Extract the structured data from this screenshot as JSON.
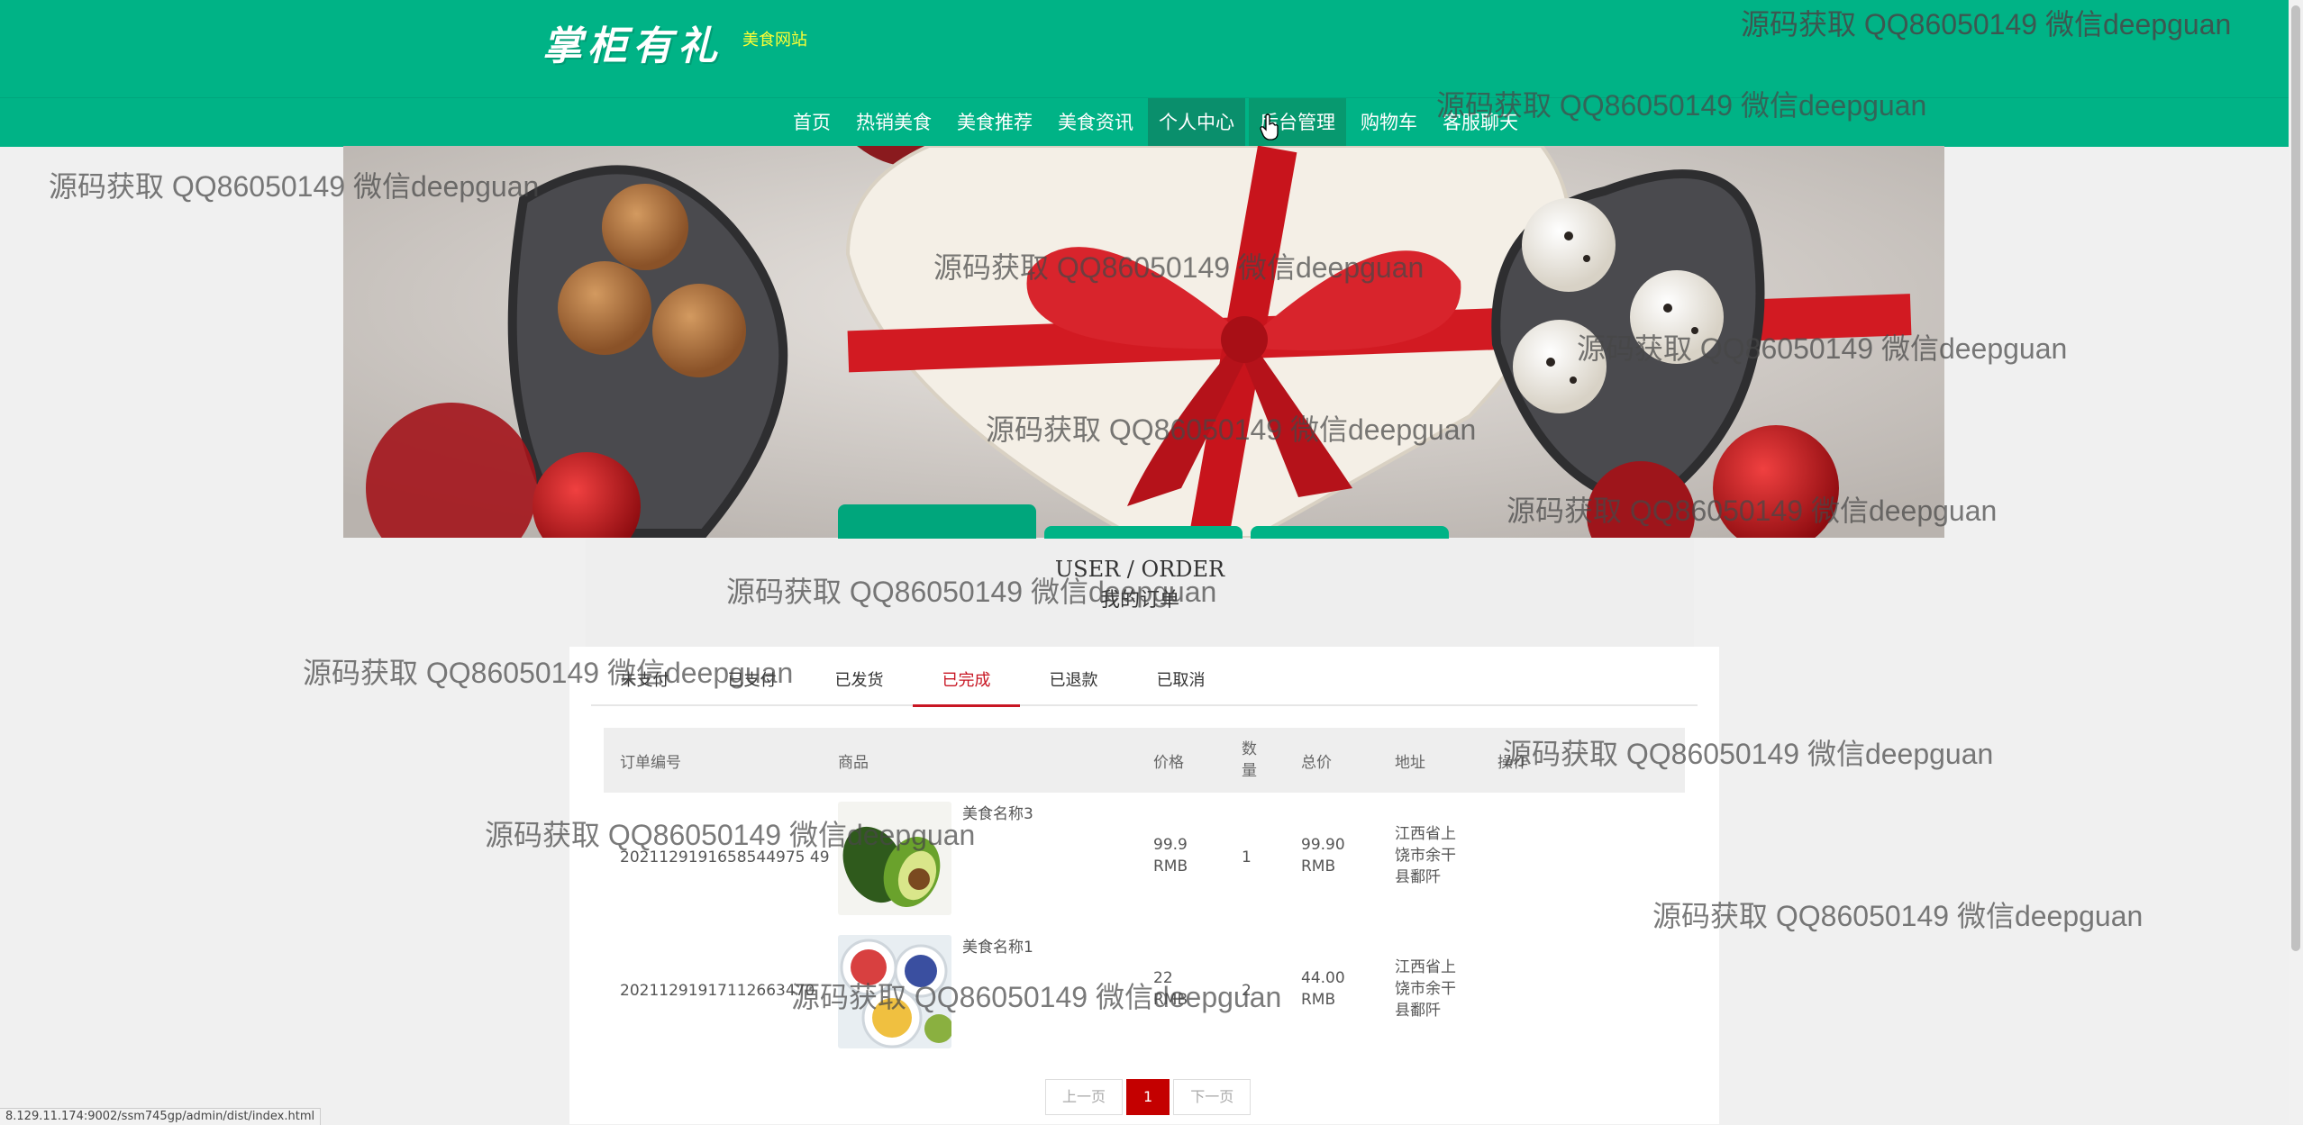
{
  "header": {
    "logo_text": "掌柜有礼",
    "logo_subtitle": "美食网站"
  },
  "nav": {
    "items": [
      {
        "label": "首页"
      },
      {
        "label": "热销美食"
      },
      {
        "label": "美食推荐"
      },
      {
        "label": "美食资讯"
      },
      {
        "label": "个人中心"
      },
      {
        "label": "后台管理"
      },
      {
        "label": "购物车"
      },
      {
        "label": "客服聊天"
      }
    ],
    "active": "个人中心",
    "hovered": "后台管理"
  },
  "order_section": {
    "heading_en": "USER / ORDER",
    "heading_cn": "我的订单"
  },
  "tabs": [
    {
      "label": "未支付"
    },
    {
      "label": "已支付"
    },
    {
      "label": "已发货"
    },
    {
      "label": "已完成"
    },
    {
      "label": "已退款"
    },
    {
      "label": "已取消"
    }
  ],
  "active_tab": "已完成",
  "table": {
    "headers": {
      "order_no": "订单编号",
      "goods": "商品",
      "price": "价格",
      "qty": "数量",
      "total": "总价",
      "address": "地址",
      "action": "操作"
    },
    "rows": [
      {
        "order_no": "20211291916585449754 9",
        "order_no_display": "2021129191658544975 49",
        "goods_name": "美食名称3",
        "price": "99.9 RMB",
        "qty": "1",
        "total": "99.90 RMB",
        "address": "江西省上饶市余干县鄱阡",
        "image": "avocado-image"
      },
      {
        "order_no_display": "20211291917112663470",
        "goods_name": "美食名称1",
        "price": "22 RMB",
        "qty": "2",
        "total": "44.00 RMB",
        "address": "江西省上饶市余干县鄱阡",
        "image": "yogurt-bowls-image"
      }
    ]
  },
  "pagination": {
    "prev": "上一页",
    "current": "1",
    "next": "下一页"
  },
  "status_bar": {
    "url": "8.129.11.174:9002/ssm745gp/admin/dist/index.html"
  },
  "watermark": "源码获取 QQ86050149 微信deepguan",
  "colors": {
    "brand_green": "#00b386",
    "active_nav": "#0a8f6c",
    "accent_red": "#c81623",
    "page_bg": "#f0f0f0"
  }
}
